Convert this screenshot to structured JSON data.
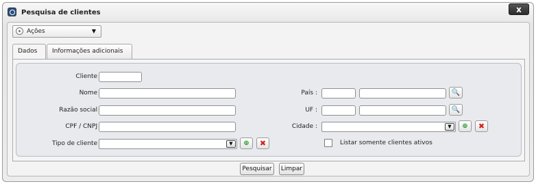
{
  "window": {
    "title": "Pesquisa de clientes",
    "close_label": "x"
  },
  "actions": {
    "label": "Ações"
  },
  "tabs": [
    {
      "label": "Dados",
      "active": true
    },
    {
      "label": "Informações adicionais",
      "active": false
    }
  ],
  "form": {
    "cliente": {
      "label": "Cliente :",
      "value": ""
    },
    "nome": {
      "label": "Nome :",
      "value": ""
    },
    "razao_social": {
      "label": "Razão social :",
      "value": ""
    },
    "cpf_cnpj": {
      "label": "CPF / CNPJ :",
      "value": ""
    },
    "tipo_cliente": {
      "label": "Tipo de cliente :",
      "selected": ""
    },
    "pais": {
      "label": "País :",
      "code": "",
      "name": ""
    },
    "uf": {
      "label": "UF :",
      "code": "",
      "name": ""
    },
    "cidade": {
      "label": "Cidade :",
      "selected": ""
    },
    "ativos": {
      "label": "Listar somente clientes ativos",
      "checked": false
    }
  },
  "buttons": {
    "search_label": "Pesquisar",
    "clear_label": "Limpar"
  },
  "icons": {
    "add": "plus-magnifier-icon",
    "remove": "red-x-icon",
    "search": "magnifier-icon",
    "gear": "gear-icon",
    "dropdown": "chevron-down-icon"
  }
}
